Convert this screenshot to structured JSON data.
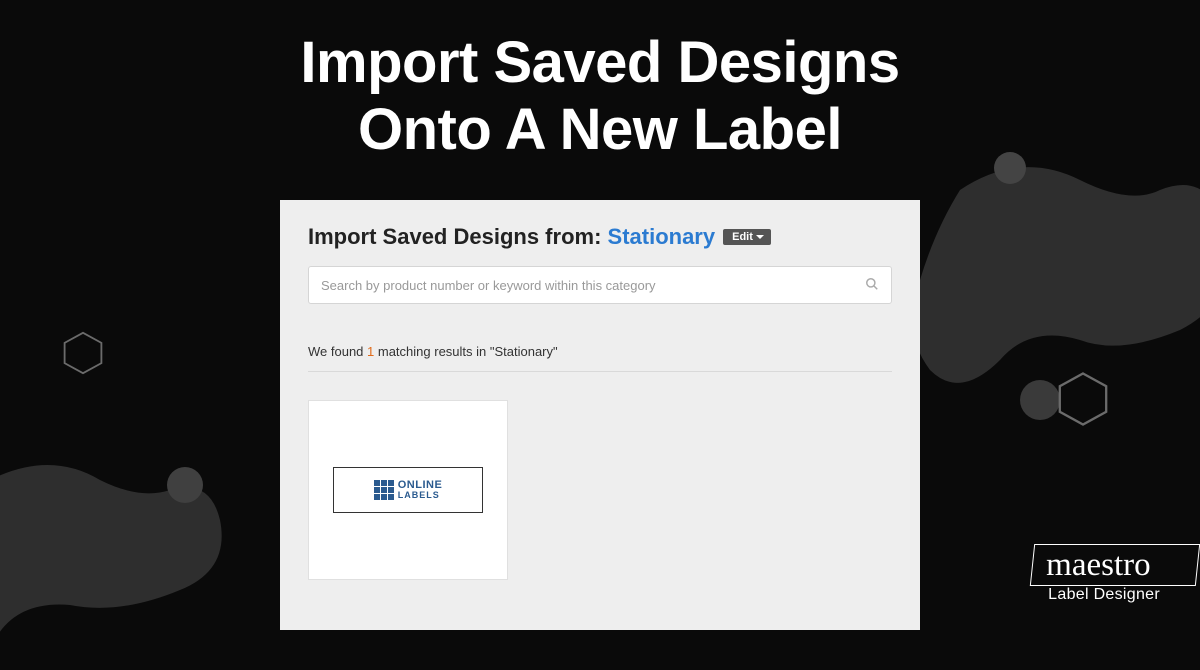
{
  "title_line1": "Import Saved Designs",
  "title_line2": "Onto A New Label",
  "panel": {
    "heading_prefix": "Import Saved Designs from: ",
    "heading_category": "Stationary",
    "edit_label": "Edit",
    "search_placeholder": "Search by product number or keyword within this category",
    "results_prefix": "We found ",
    "results_count": "1",
    "results_suffix": " matching results in \"Stationary\"",
    "thumb_line1": "ONLINE",
    "thumb_line2": "LABELS"
  },
  "brand": {
    "main": "maestro",
    "sub": "Label Designer"
  }
}
